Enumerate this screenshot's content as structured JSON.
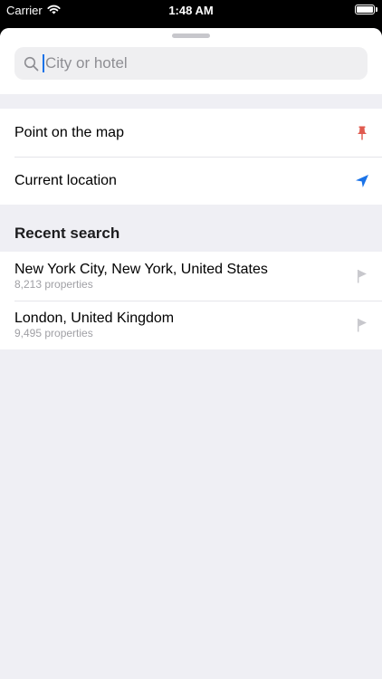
{
  "status_bar": {
    "carrier": "Carrier",
    "time": "1:48 AM"
  },
  "search": {
    "placeholder": "City or hotel",
    "value": ""
  },
  "quick_options": [
    {
      "label": "Point on the map",
      "icon": "pin-icon",
      "icon_color": "#e05a4f"
    },
    {
      "label": "Current location",
      "icon": "location-arrow-icon",
      "icon_color": "#1a73e8"
    }
  ],
  "recent": {
    "header": "Recent search",
    "items": [
      {
        "title": "New York City, New York, United States",
        "subtitle": "8,213 properties",
        "icon": "flag-icon"
      },
      {
        "title": "London, United Kingdom",
        "subtitle": "9,495 properties",
        "icon": "flag-icon"
      }
    ]
  },
  "colors": {
    "accent": "#1a73e8",
    "pin": "#e05a4f",
    "flag": "#c7c7cc",
    "background": "#efeff4"
  }
}
